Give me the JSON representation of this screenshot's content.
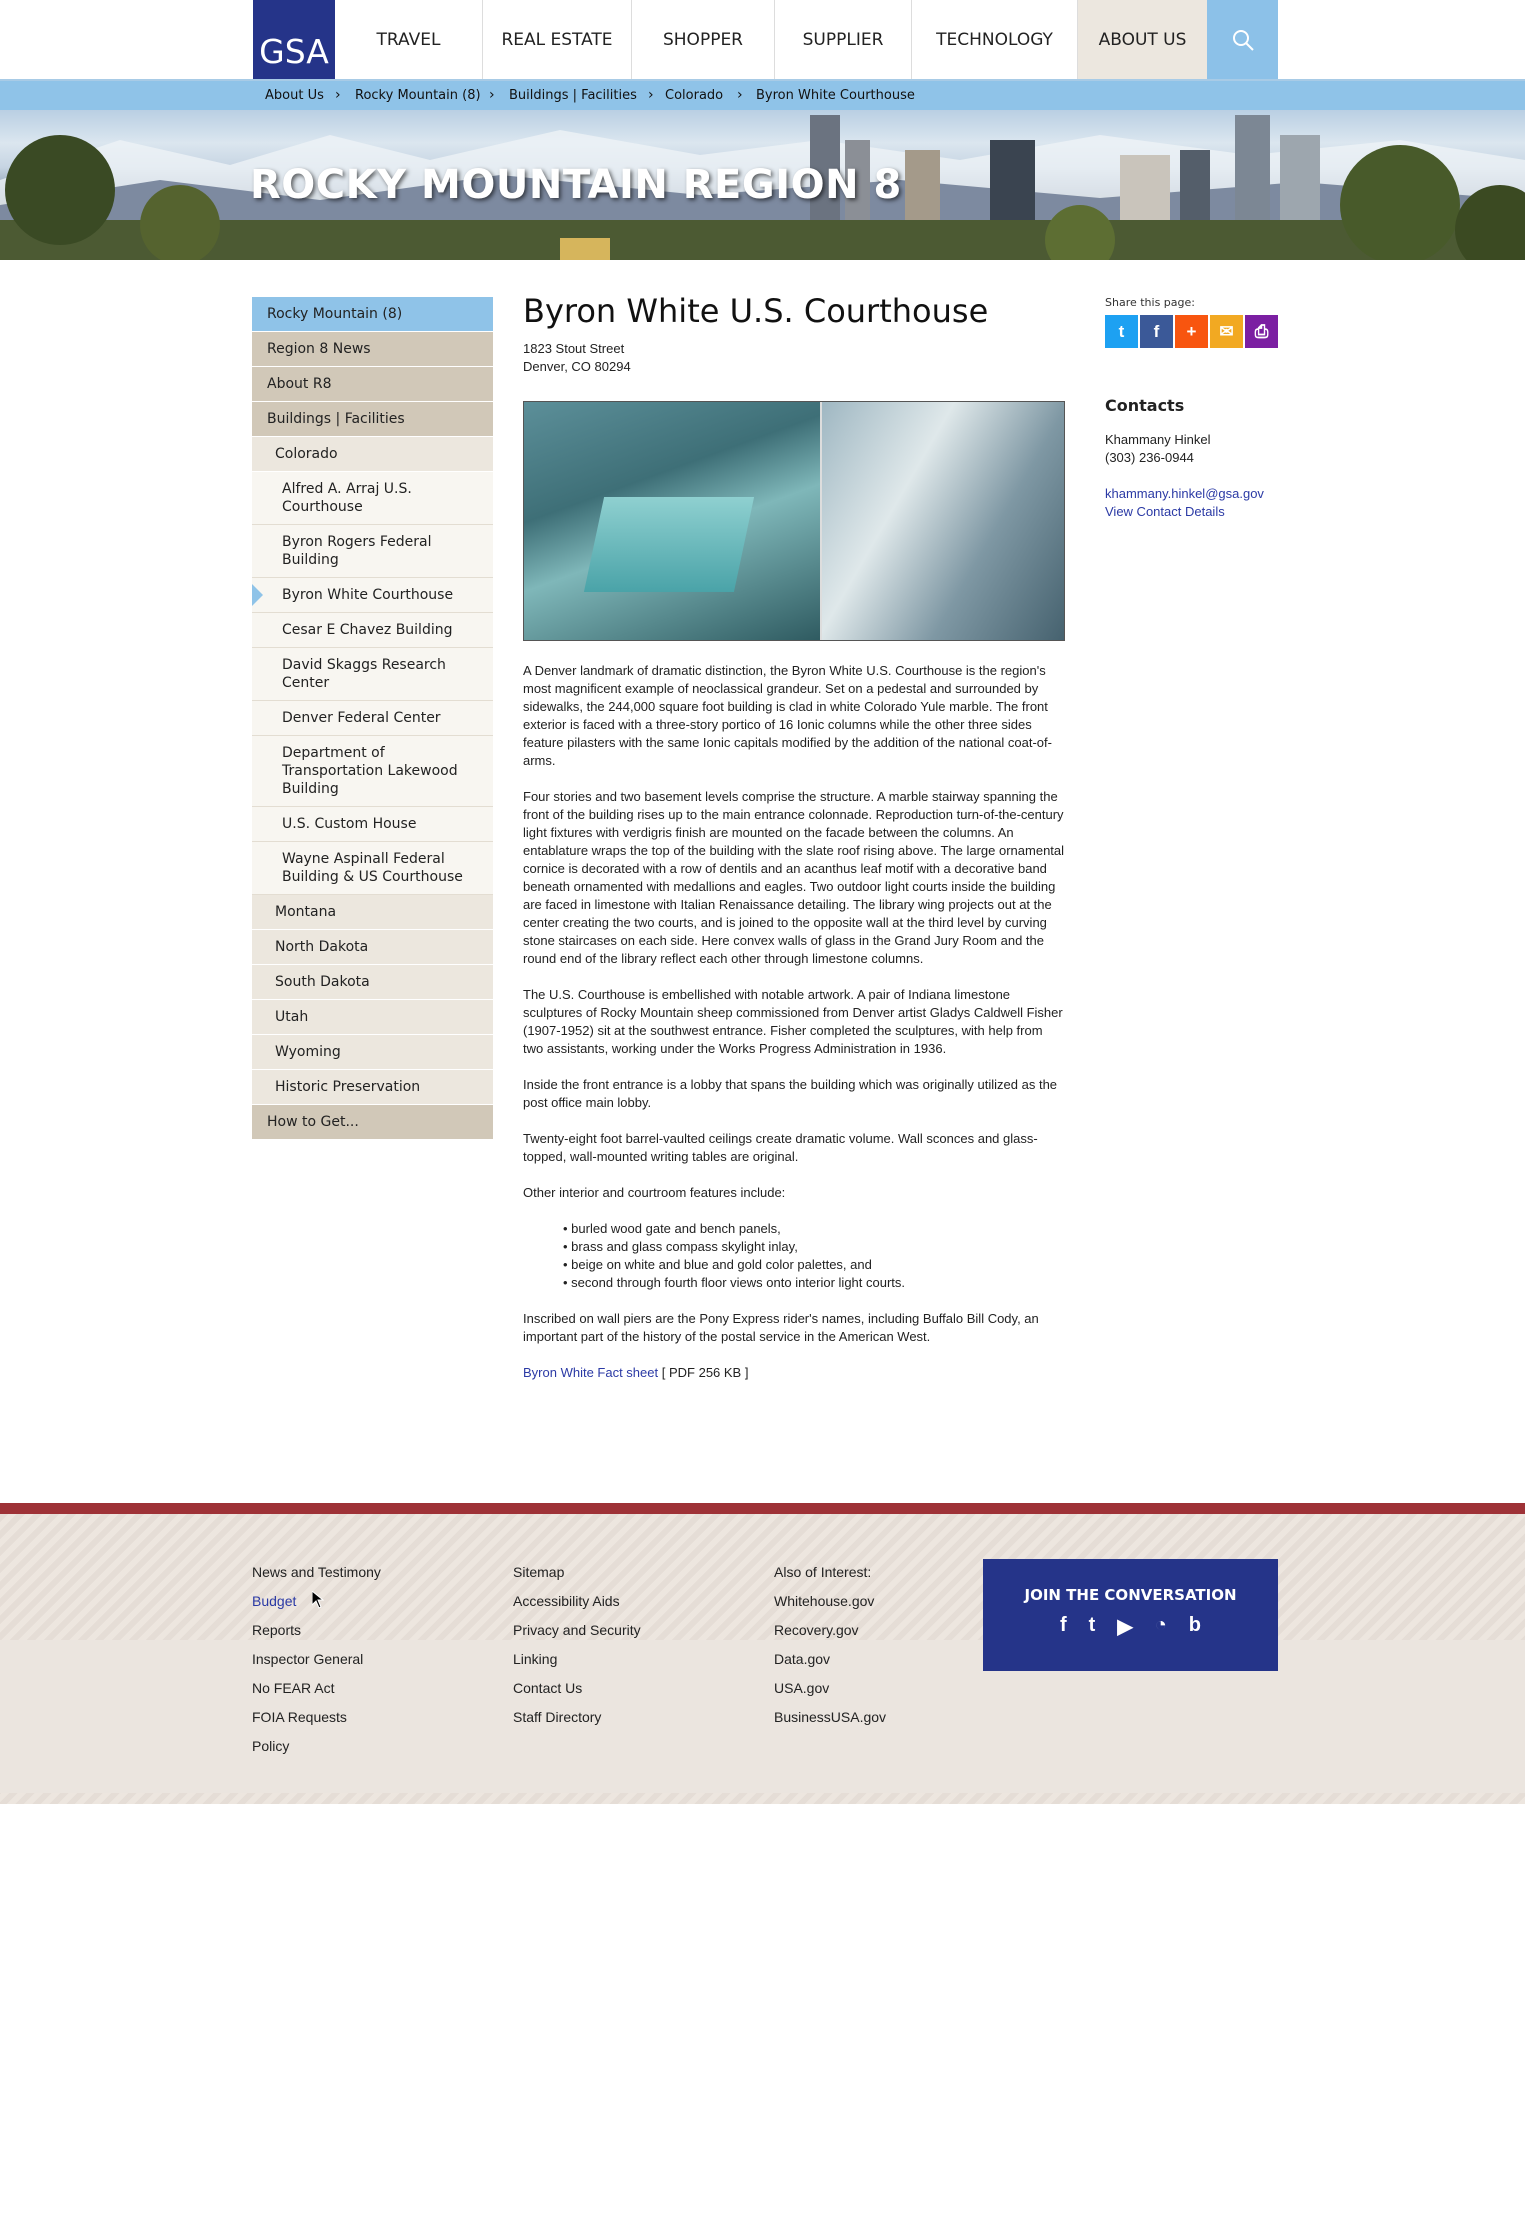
{
  "logo": "GSA",
  "nav": [
    "TRAVEL",
    "REAL ESTATE",
    "SHOPPER",
    "SUPPLIER",
    "TECHNOLOGY",
    "ABOUT US"
  ],
  "breadcrumb": [
    "About Us",
    "Rocky Mountain (8)",
    "Buildings | Facilities",
    "Colorado",
    "Byron White Courthouse"
  ],
  "hero_title": "ROCKY MOUNTAIN REGION 8",
  "sidebar": [
    {
      "label": "Rocky Mountain (8)",
      "level": 0
    },
    {
      "label": "Region 8 News",
      "level": 0
    },
    {
      "label": "About R8",
      "level": 0
    },
    {
      "label": "Buildings | Facilities",
      "level": 0
    },
    {
      "label": "Colorado",
      "level": 1
    },
    {
      "label": "Alfred A. Arraj U.S. Courthouse",
      "level": 2
    },
    {
      "label": "Byron Rogers Federal Building",
      "level": 2
    },
    {
      "label": "Byron White Courthouse",
      "level": 2
    },
    {
      "label": "Cesar E Chavez Building",
      "level": 2
    },
    {
      "label": "David Skaggs Research Center",
      "level": 2
    },
    {
      "label": "Denver Federal Center",
      "level": 2
    },
    {
      "label": "Department of Transportation Lakewood Building",
      "level": 2
    },
    {
      "label": "U.S. Custom House",
      "level": 2
    },
    {
      "label": "Wayne Aspinall Federal Building & US Courthouse",
      "level": 2
    },
    {
      "label": "Montana",
      "level": 1
    },
    {
      "label": "North Dakota",
      "level": 1
    },
    {
      "label": "South Dakota",
      "level": 1
    },
    {
      "label": "Utah",
      "level": 1
    },
    {
      "label": "Wyoming",
      "level": 1
    },
    {
      "label": "Historic Preservation",
      "level": 1
    },
    {
      "label": "How to Get...",
      "level": 0
    }
  ],
  "main": {
    "title": "Byron White U.S. Courthouse",
    "address_line1": "1823 Stout Street",
    "address_line2": "Denver, CO 80294",
    "p1": "A Denver landmark of dramatic distinction, the Byron White U.S. Courthouse is the region's most magnificent example of neoclassical grandeur. Set on a pedestal and surrounded by sidewalks, the 244,000 square foot building is clad in white Colorado Yule marble. The front exterior is faced with a three-story portico of 16 Ionic columns while the other three sides feature pilasters with the same Ionic capitals modified by the addition of the national coat-of-arms.",
    "p2": "Four stories and two basement levels comprise the structure. A marble stairway spanning the front of the building rises up to the main entrance colonnade. Reproduction turn-of-the-century light fixtures with verdigris finish are mounted on the facade between the columns. An entablature wraps the top of the building with the slate roof rising above. The large ornamental cornice is decorated with a row of dentils and an acanthus leaf motif with a decorative band beneath ornamented with medallions and eagles. Two outdoor light courts inside the building are faced in limestone with Italian Renaissance detailing. The library wing projects out at the center creating the two courts, and is joined to the opposite wall at the third level by curving stone staircases on each side. Here convex walls of glass in the Grand Jury Room and the round end of the library reflect each other through limestone columns.",
    "p3": "The U.S. Courthouse is embellished with notable artwork. A pair of Indiana limestone sculptures of Rocky Mountain sheep commissioned from Denver artist Gladys Caldwell Fisher (1907-1952) sit at the southwest entrance. Fisher completed the sculptures, with help from two assistants, working under the Works Progress Administration in 1936.",
    "p4": "Inside the front entrance is a lobby that spans the building which was originally utilized as the post office main lobby.",
    "p5": "Twenty-eight foot barrel-vaulted ceilings create dramatic volume. Wall sconces and glass-topped, wall-mounted writing tables are original.",
    "p6": "Other interior and courtroom features include:",
    "list": [
      "burled wood gate and bench panels,",
      "brass and glass compass skylight inlay,",
      "beige on white and blue and gold color palettes, and",
      "second through fourth floor views onto interior light courts."
    ],
    "p7": "Inscribed on wall piers are the Pony Express rider's names, including Buffalo Bill Cody, an important part of the history of the postal service in the American West.",
    "fact_link": "Byron White Fact sheet",
    "fact_meta": "[ PDF 256 KB ]"
  },
  "share": {
    "label": "Share this page:",
    "icons": [
      {
        "name": "twitter-icon",
        "glyph": "t",
        "color": "#1da1f2"
      },
      {
        "name": "facebook-icon",
        "glyph": "f",
        "color": "#3b5998"
      },
      {
        "name": "addthis-icon",
        "glyph": "+",
        "color": "#f8550f"
      },
      {
        "name": "email-icon",
        "glyph": "✉",
        "color": "#f2a922"
      },
      {
        "name": "print-icon",
        "glyph": "⎙",
        "color": "#7b1fa2"
      }
    ]
  },
  "contacts": {
    "heading": "Contacts",
    "name": "Khammany Hinkel",
    "phone": "(303) 236-0944",
    "email": "khammany.hinkel@gsa.gov",
    "details_link": "View Contact Details"
  },
  "footer": {
    "col1": [
      "News and Testimony",
      "Budget",
      "Reports",
      "Inspector General",
      "No FEAR Act",
      "FOIA Requests",
      "Policy"
    ],
    "col2": [
      "Sitemap",
      "Accessibility Aids",
      "Privacy and Security",
      "Linking",
      "Contact Us",
      "Staff Directory"
    ],
    "col3": [
      "Also of Interest:",
      "Whitehouse.gov",
      "Recovery.gov",
      "Data.gov",
      "USA.gov",
      "BusinessUSA.gov"
    ],
    "join_title": "JOIN THE CONVERSATION",
    "join_icons": [
      {
        "name": "facebook-icon",
        "glyph": "f"
      },
      {
        "name": "twitter-icon",
        "glyph": "t"
      },
      {
        "name": "youtube-icon",
        "glyph": "▶"
      },
      {
        "name": "rss-icon",
        "glyph": "◔"
      },
      {
        "name": "blog-icon",
        "glyph": "b"
      }
    ]
  },
  "colors": {
    "gsa_blue": "#253489",
    "nav_light_blue": "#8fc3e8",
    "footer_red": "#9e3237",
    "link": "#2b3aa5"
  }
}
